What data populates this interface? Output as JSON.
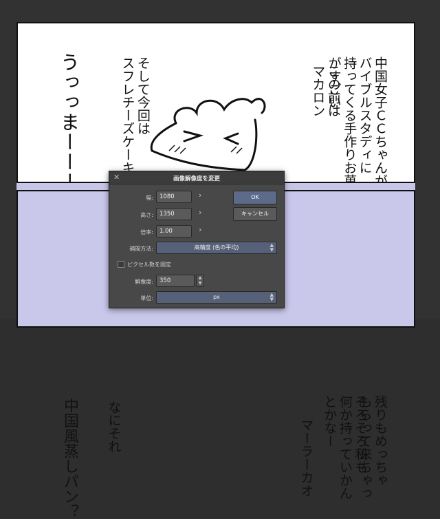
{
  "comic": {
    "top_panel": {
      "text_right": "中国女子ＣＣちゃんが\nバイブルスタディに\n持ってくる手作りお菓子\nがすごい",
      "text_mid": "この前は\nマカロン",
      "text_left": "そして今回は\nスフレチーズケーキ",
      "text_exclaim": "うっっまーーーー"
    },
    "bottom_panel": {
      "text_right": "残りもめっちゃ\nもらって来ちゃっ",
      "text_mid": "そろそろ私も\n何か持っていかん\nとかなー",
      "text_mid2": "マーラーカオ",
      "text_left": "なにそれ",
      "text_far_left": "中国風蒸しパン？"
    }
  },
  "dialog": {
    "title": "画像解像度を変更",
    "close_icon": "close-icon",
    "width_label": "幅:",
    "width_value": "1080",
    "height_label": "高さ:",
    "height_value": "1350",
    "scale_label": "倍率:",
    "scale_value": "1.00",
    "interp_label": "補間方法:",
    "interp_value": "高精度 (色の平均)",
    "fix_pixels_label": "ピクセル数を固定",
    "resolution_label": "解像度:",
    "resolution_value": "350",
    "unit_label": "単位:",
    "unit_value": "px",
    "ok_label": "OK",
    "cancel_label": "キャンセル"
  },
  "colors": {
    "background": "#2e2e2e",
    "panel_white": "#ffffff",
    "panel_lavender": "#c9c7ea",
    "dialog_bg": "#484848",
    "ok_button": "#5d6b8a"
  }
}
